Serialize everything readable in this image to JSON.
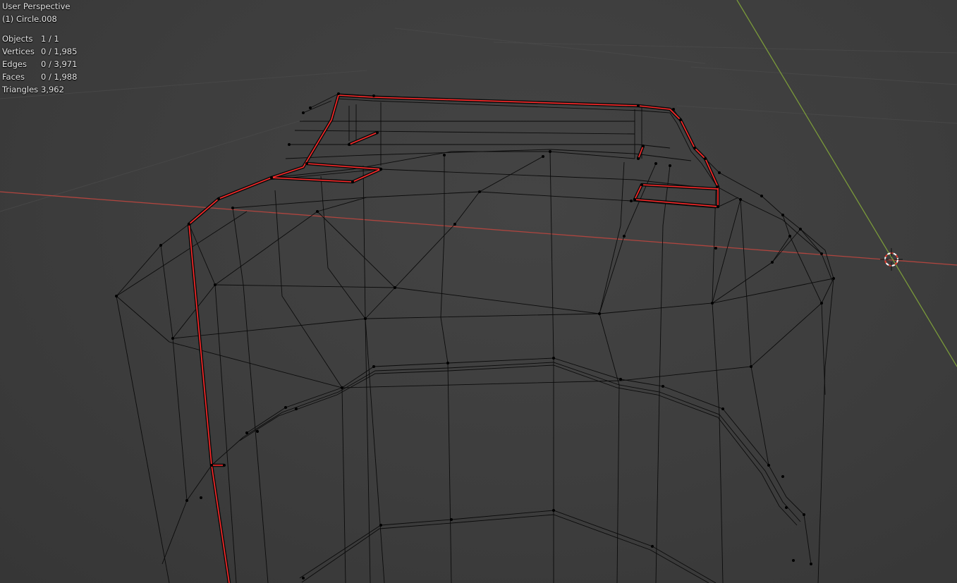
{
  "viewport": {
    "view_name": "User Perspective",
    "object_name": "(1) Circle.008"
  },
  "stats": [
    {
      "label": "Objects",
      "value": "1 / 1"
    },
    {
      "label": "Vertices",
      "value": "0 / 1,985"
    },
    {
      "label": "Edges",
      "value": "0 / 3,971"
    },
    {
      "label": "Faces",
      "value": "0 / 1,988"
    },
    {
      "label": "Triangles",
      "value": "3,962"
    }
  ],
  "colors": {
    "background": "#3d3d3d",
    "wire": "#0b0b0b",
    "seam": "#ff2a2a",
    "x_axis": "#b0453f",
    "y_axis": "#7a9a3a",
    "grid": "#4a4a4a"
  }
}
